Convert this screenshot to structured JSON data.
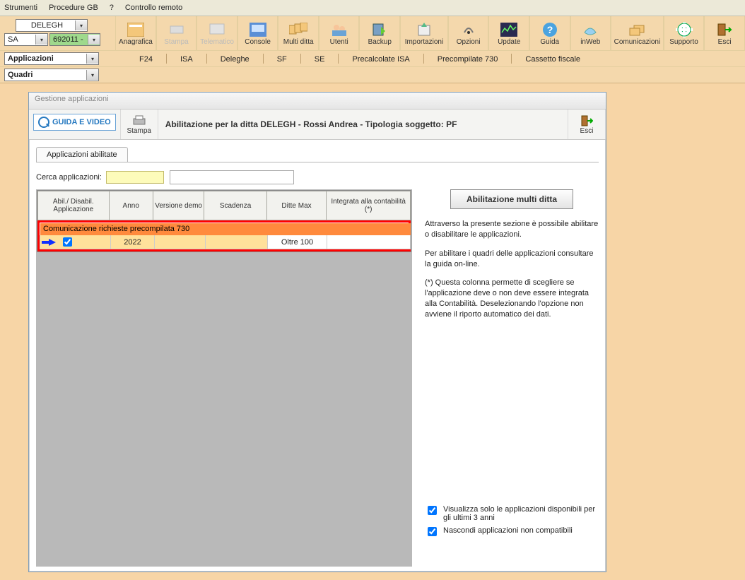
{
  "menu": {
    "strumenti": "Strumenti",
    "procedure": "Procedure GB",
    "help": "?",
    "remoto": "Controllo remoto"
  },
  "selectors": {
    "ditta": "DELEGH",
    "sa": "SA",
    "year": "692011 -"
  },
  "toolbar": {
    "anagrafica": "Anagrafica",
    "stampa": "Stampa",
    "telematico": "Telematico",
    "console": "Console",
    "multi": "Multi ditta",
    "utenti": "Utenti",
    "backup": "Backup",
    "import": "Importazioni",
    "opzioni": "Opzioni",
    "update": "Update",
    "guida": "Guida",
    "inweb": "inWeb",
    "comunic": "Comunicazioni",
    "supporto": "Supporto",
    "esci": "Esci"
  },
  "leftboxes": {
    "applicazioni": "Applicazioni",
    "quadri": "Quadri"
  },
  "subtabs": {
    "f24": "F24",
    "isa": "ISA",
    "deleghe": "Deleghe",
    "sf": "SF",
    "se": "SE",
    "precalc": "Precalcolate ISA",
    "precomp": "Precompilate 730",
    "cassetto": "Cassetto fiscale"
  },
  "inner": {
    "wintitle": "Gestione applicazioni",
    "guida": "GUIDA E VIDEO",
    "stampa": "Stampa",
    "esci": "Esci",
    "header": "Abilitazione per la ditta DELEGH -  Rossi Andrea - Tipologia soggetto: PF",
    "tab": "Applicazioni abilitate",
    "search_label": "Cerca applicazioni:"
  },
  "grid": {
    "h1": "Abil./ Disabil. Applicazione",
    "h2": "Anno",
    "h3": "Versione demo",
    "h4": "Scadenza",
    "h5": "Ditte Max",
    "h6": "Integrata alla contabilità (*)",
    "group": "Comunicazione richieste precompilata 730",
    "row": {
      "anno": "2022",
      "ditte": "Oltre 100"
    }
  },
  "side": {
    "bigbtn": "Abilitazione multi ditta",
    "p1": "Attraverso la presente sezione è possibile abilitare o disabilitare le applicazioni.",
    "p2": "Per abilitare i quadri delle applicazioni consultare la guida on-line.",
    "p3": "(*) Questa colonna permette di scegliere se l'applicazione deve o non deve essere integrata alla Contabilità. Deselezionando l'opzione non avviene il riporto automatico dei dati.",
    "chk1": "Visualizza solo le applicazioni disponibili per gli ultimi 3 anni",
    "chk2": "Nascondi applicazioni non compatibili"
  }
}
